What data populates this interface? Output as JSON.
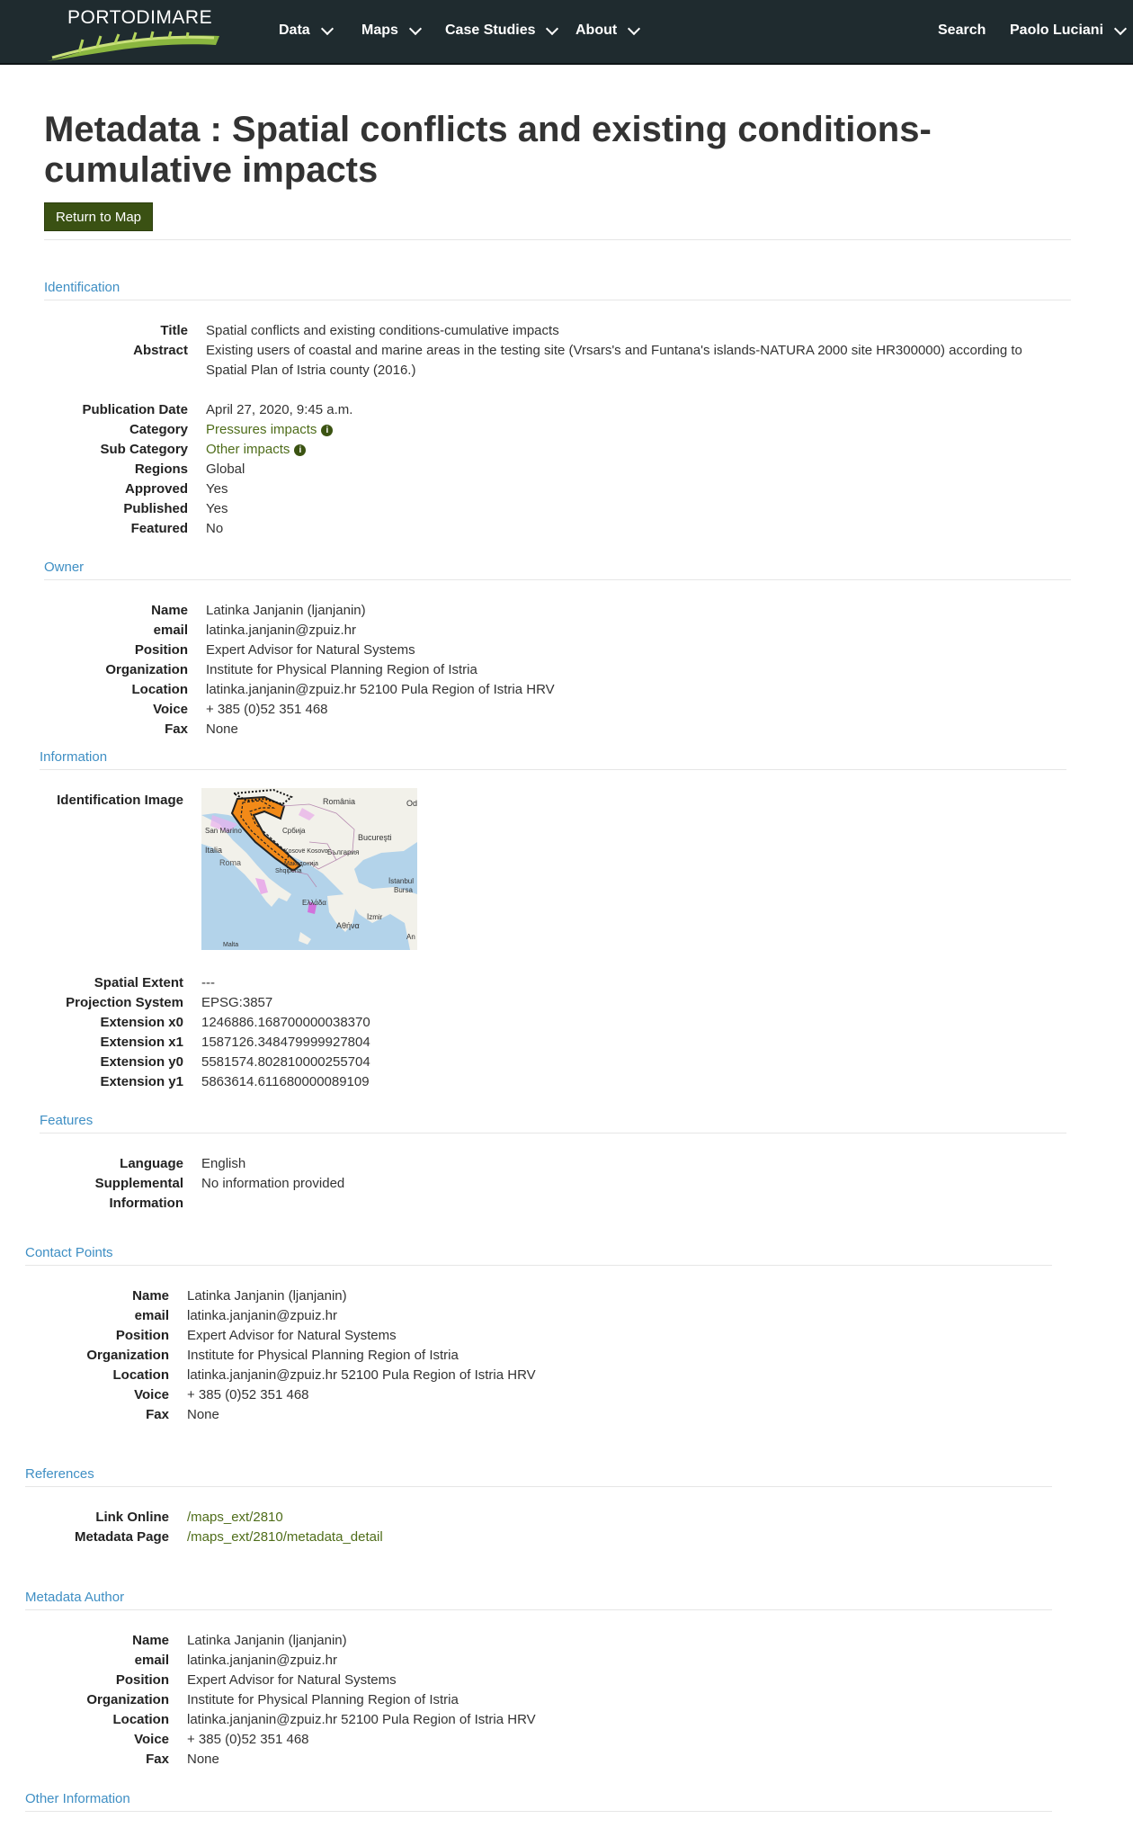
{
  "nav": {
    "brand": "PORTODIMARE",
    "menu": [
      "Data",
      "Maps",
      "Case Studies",
      "About"
    ],
    "search": "Search",
    "user": "Paolo Luciani"
  },
  "page": {
    "title": "Metadata : Spatial conflicts and existing conditions-cumulative impacts",
    "return_button": "Return to Map"
  },
  "identification": {
    "heading": "Identification",
    "title_label": "Title",
    "title": "Spatial conflicts and existing conditions-cumulative impacts",
    "abstract_label": "Abstract",
    "abstract_line1": "Existing users of coastal and marine areas in the testing site (Vrsars's and Funtana's islands-NATURA 2000 site HR300000) according to",
    "abstract_line2": "Spatial Plan of Istria county (2016.)",
    "pubdate_label": "Publication Date",
    "pubdate": "April 27, 2020, 9:45 a.m.",
    "category_label": "Category",
    "category": "Pressures impacts",
    "subcategory_label": "Sub Category",
    "subcategory": "Other impacts",
    "regions_label": "Regions",
    "regions": "Global",
    "approved_label": "Approved",
    "approved": "Yes",
    "published_label": "Published",
    "published": "Yes",
    "featured_label": "Featured",
    "featured": "No"
  },
  "labels": {
    "name": "Name",
    "email": "email",
    "position": "Position",
    "organization": "Organization",
    "location": "Location",
    "voice": "Voice",
    "fax": "Fax"
  },
  "contact": {
    "name": "Latinka Janjanin (ljanjanin)",
    "email": "latinka.janjanin@zpuiz.hr",
    "position": "Expert Advisor for Natural Systems",
    "organization": "Institute for Physical Planning Region of Istria",
    "location": "latinka.janjanin@zpuiz.hr 52100 Pula Region of Istria HRV",
    "voice": "+ 385 (0)52 351 468",
    "fax": "None"
  },
  "owner": {
    "heading": "Owner"
  },
  "information": {
    "heading": "Information",
    "image_label": "Identification Image",
    "map_labels": [
      "România",
      "Bucureşti",
      "San Marino",
      "Србија",
      "Italia",
      "Kosovë Kosovo",
      "България",
      "Roma",
      "Македонија",
      "Shqipëria",
      "İstanbul",
      "Bursa",
      "Ελλάδα",
      "İzmir",
      "Αθήνα",
      "Malta",
      "Od",
      "An"
    ],
    "extent_label": "Spatial Extent",
    "extent": "---",
    "projection_label": "Projection System",
    "projection": "EPSG:3857",
    "x0_label": "Extension x0",
    "x0": "1246886.168700000038370",
    "x1_label": "Extension x1",
    "x1": "1587126.348479999927804",
    "y0_label": "Extension y0",
    "y0": "5581574.802810000255704",
    "y1_label": "Extension y1",
    "y1": "5863614.611680000089109"
  },
  "features": {
    "heading": "Features",
    "language_label": "Language",
    "language": "English",
    "supp_label_1": "Supplemental",
    "supp_label_2": "Information",
    "supp": "No information provided"
  },
  "contact_points": {
    "heading": "Contact Points"
  },
  "references": {
    "heading": "References",
    "link_label": "Link Online",
    "link": "/maps_ext/2810",
    "meta_label": "Metadata Page",
    "meta": "/maps_ext/2810/metadata_detail"
  },
  "metadata_author": {
    "heading": "Metadata Author"
  },
  "other": {
    "heading": "Other Information"
  },
  "colors": {
    "navbar": "#1f2b2f",
    "accent_green": "#3a5113",
    "link_green": "#4f6d1a",
    "section_blue": "#3f8fc4"
  }
}
